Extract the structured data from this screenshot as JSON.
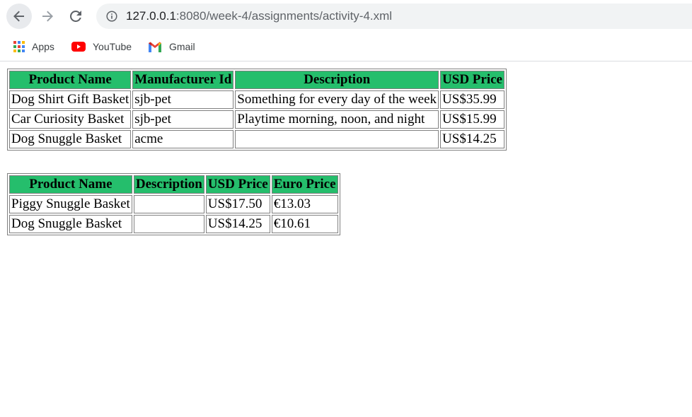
{
  "browser": {
    "url_host": "127.0.0.1",
    "url_rest": ":8080/week-4/assignments/activity-4.xml",
    "bookmarks": [
      {
        "label": "Apps",
        "icon": "apps-grid-icon"
      },
      {
        "label": "YouTube",
        "icon": "youtube-icon"
      },
      {
        "label": "Gmail",
        "icon": "gmail-icon"
      }
    ]
  },
  "colors": {
    "header_bg": "#25be6c",
    "youtube_red": "#ff0000",
    "chrome_gray": "#f1f3f4"
  },
  "table1": {
    "headers": [
      "Product Name",
      "Manufacturer Id",
      "Description",
      "USD Price"
    ],
    "rows": [
      [
        "Dog Shirt Gift Basket",
        "sjb-pet",
        "Something for every day of the week",
        "US$35.99"
      ],
      [
        "Car Curiosity Basket",
        "sjb-pet",
        "Playtime morning, noon, and night",
        "US$15.99"
      ],
      [
        "Dog Snuggle Basket",
        "acme",
        "",
        "US$14.25"
      ]
    ]
  },
  "table2": {
    "headers": [
      "Product Name",
      "Description",
      "USD Price",
      "Euro Price"
    ],
    "rows": [
      [
        "Piggy Snuggle Basket",
        "",
        "US$17.50",
        "€13.03"
      ],
      [
        "Dog Snuggle Basket",
        "",
        "US$14.25",
        "€10.61"
      ]
    ]
  }
}
